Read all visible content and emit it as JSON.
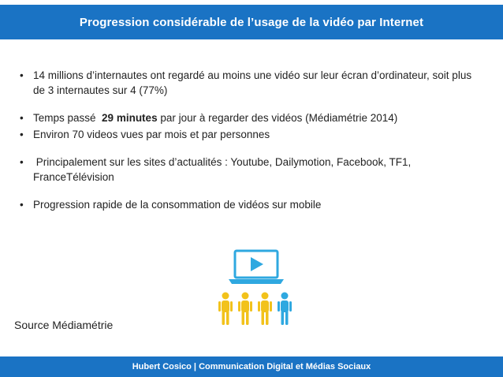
{
  "header": {
    "title": "Progression considérable de l’usage de la vidéo par Internet"
  },
  "bullets": [
    {
      "text": "14 millions d’internautes ont regardé au moins une vidéo sur leur écran d’ordinateur, soit plus de 3 internautes sur 4 (77%)"
    },
    {
      "before": "Temps passé  ",
      "bold": "29 minutes",
      "after": " par jour à regarder des vidéos (Médiamétrie 2014)"
    },
    {
      "text": "Environ 70 videos vues par mois et par personnes"
    },
    {
      "text": " Principalement sur les sites d’actualités : Youtube, Dailymotion, Facebook, TF1, FranceTélévision"
    },
    {
      "text": "Progression rapide de la consommation de vidéos sur mobile"
    }
  ],
  "bullet_symbol": "•",
  "source": "Source Médiamétrie",
  "footer": {
    "text": "Hubert Cosico | Communication Digital et Médias Sociaux"
  },
  "colors": {
    "brand_blue": "#1a73c4",
    "icon_blue": "#2fa8e0",
    "icon_yellow": "#f2c21b"
  },
  "icons": [
    "laptop-play-icon",
    "person-icon"
  ]
}
